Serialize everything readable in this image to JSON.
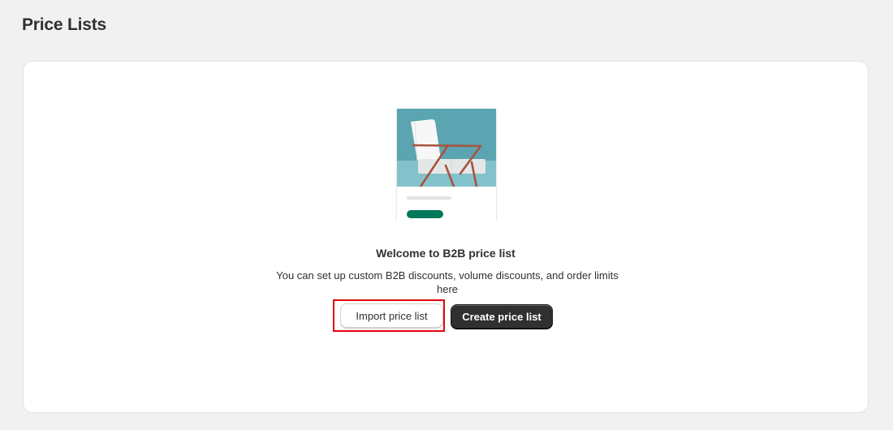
{
  "page": {
    "title": "Price Lists"
  },
  "empty_state": {
    "illustration_name": "price-list-illustration",
    "heading": "Welcome to B2B price list",
    "description": "You can set up custom B2B discounts, volume discounts, and order limits here",
    "secondary_action_label": "Import price list",
    "primary_action_label": "Create price list"
  },
  "colors": {
    "page_background": "#f1f1f1",
    "card_background": "#ffffff",
    "primary_button": "#303030",
    "highlight_border": "#e0060d",
    "illustration_sky": "#5aa5b1",
    "illustration_chair_frame": "#a9533d",
    "illustration_badge": "#00785a"
  }
}
